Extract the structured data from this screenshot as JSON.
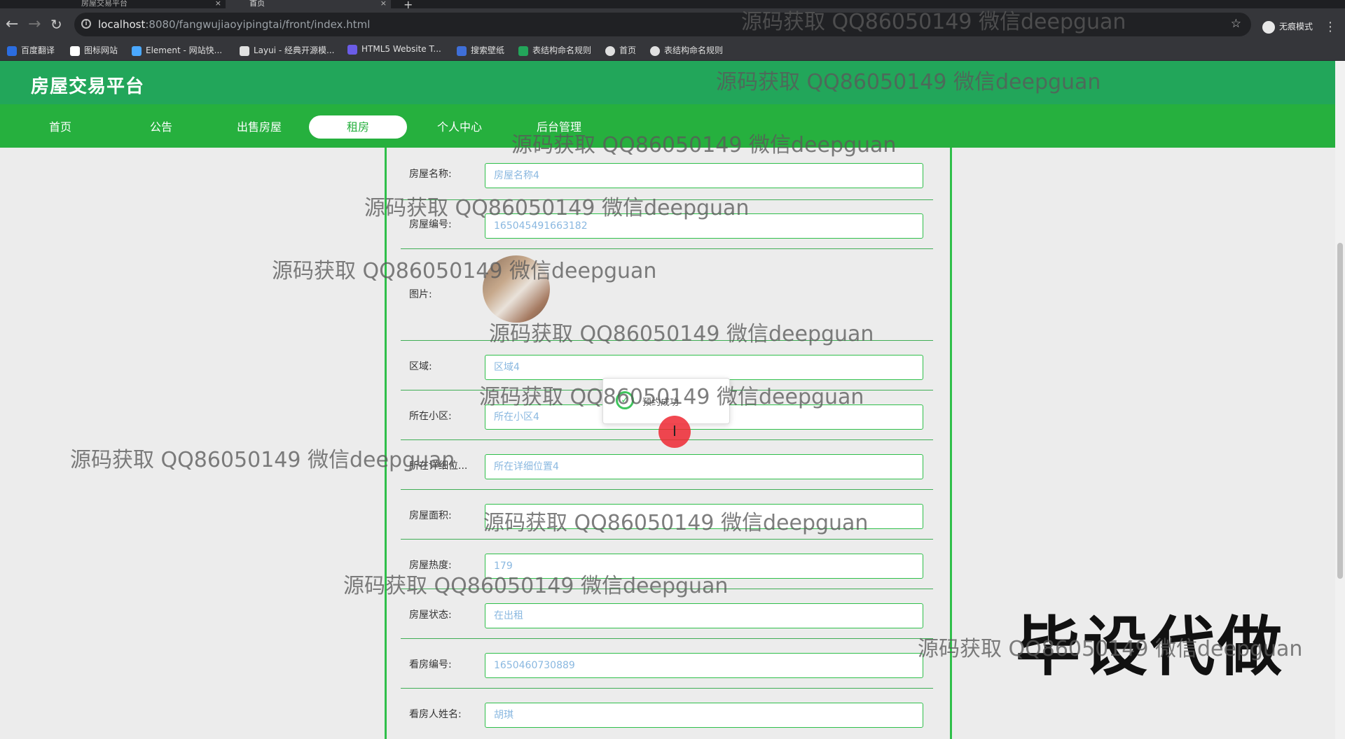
{
  "browser": {
    "tabs": [
      {
        "title": "房屋交易平台",
        "active": false
      },
      {
        "title": "首页",
        "active": true
      }
    ],
    "url_host": "localhost",
    "url_rest": ":8080/fangwujiaoyipingtai/front/index.html",
    "incognito_label": "无痕模式",
    "bookmarks": [
      {
        "label": "百度翻译",
        "color": "#2b6de0"
      },
      {
        "label": "图标网站",
        "color": "#ffffff"
      },
      {
        "label": "Element - 网站快...",
        "color": "#4aa8ff"
      },
      {
        "label": "Layui - 经典开源模...",
        "color": "#e0e0e0"
      },
      {
        "label": "HTML5 Website T...",
        "color": "#6b5ce7"
      },
      {
        "label": "搜索壁纸",
        "color": "#3f6fd8"
      },
      {
        "label": "表结构命名规则",
        "color": "#23a55a"
      },
      {
        "label": "首页",
        "color": "#e0e0e0"
      },
      {
        "label": "表结构命名规则",
        "color": "#e0e0e0"
      }
    ]
  },
  "site": {
    "title": "房屋交易平台",
    "nav": [
      "首页",
      "公告",
      "出售房屋",
      "租房",
      "个人中心",
      "后台管理"
    ],
    "active_nav": "租房",
    "accent_color": "#26b03e"
  },
  "form": {
    "name_label": "房屋名称:",
    "name_value": "房屋名称4",
    "code_label": "房屋编号:",
    "code_value": "165045491663182",
    "photo_label": "图片:",
    "area_label": "区域:",
    "area_value": "区域4",
    "community_label": "所在小区:",
    "community_value": "所在小区4",
    "address_label": "所在详细位...",
    "address_value": "所在详细位置4",
    "size_label": "房屋面积:",
    "size_value": "",
    "heat_label": "房屋热度:",
    "heat_value": "179",
    "status_label": "房屋状态:",
    "status_value": "在出租",
    "viewing_code_label": "看房编号:",
    "viewing_code_value": "1650460730889",
    "viewer_name_label": "看房人姓名:",
    "viewer_name_value": "胡琪"
  },
  "toast": {
    "message": "预约成功"
  },
  "overlay": {
    "watermark": "源码获取 QQ86050149 微信deepguan",
    "badge": "毕设代做"
  }
}
